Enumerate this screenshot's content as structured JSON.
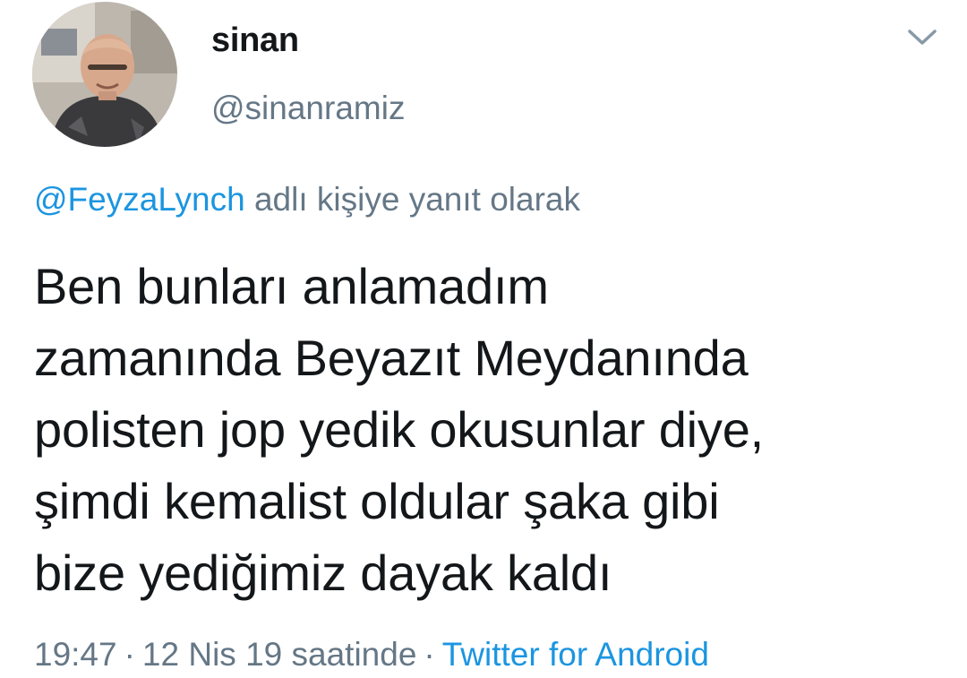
{
  "tweet": {
    "display_name": "sinan",
    "handle": "@sinanramiz",
    "avatar_icon": "user-avatar-photo",
    "menu_icon": "chevron-down-icon",
    "reply_mention": "@FeyzaLynch",
    "reply_suffix": "adlı kişiye yanıt olarak",
    "text_lines": [
      "Ben bunları anlamadım",
      "zamanında Beyazıt Meydanında",
      "polisten jop yedik okusunlar diye,",
      "şimdi kemalist oldular şaka gibi",
      "bize yediğimiz dayak kaldı"
    ],
    "time": "19:47",
    "date_text": "12 Nis 19 saatinde",
    "separator": "·",
    "source": "Twitter for Android"
  },
  "colors": {
    "text": "#14171a",
    "secondary": "#657786",
    "link": "#1b95e0",
    "background": "#ffffff"
  }
}
